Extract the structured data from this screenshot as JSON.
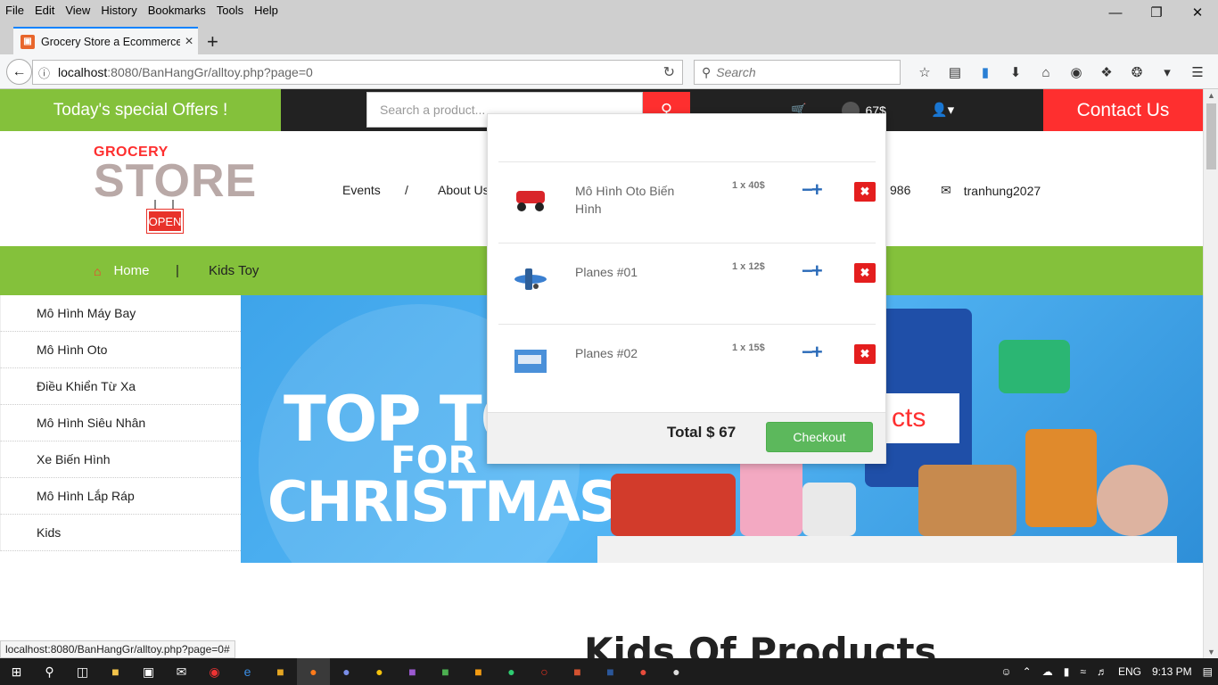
{
  "browser": {
    "menu": [
      "File",
      "Edit",
      "View",
      "History",
      "Bookmarks",
      "Tools",
      "Help"
    ],
    "tab_title": "Grocery Store a Ecommerce",
    "url_host": "localhost",
    "url_path": ":8080/BanHangGr/alltoy.php?page=0",
    "search_placeholder": "Search",
    "status_url": "localhost:8080/BanHangGr/alltoy.php?page=0#"
  },
  "header": {
    "offers": "Today's special Offers !",
    "search_placeholder": "Search a product...",
    "cart_amount": "67$",
    "contact": "Contact Us"
  },
  "logo": {
    "top": "GROCERY",
    "main": "STORE",
    "sign": "OPEN"
  },
  "midnav": {
    "events": "Events",
    "sep": "/",
    "about": "About Us",
    "phone": "986",
    "email": "tranhung2027"
  },
  "breadcrumb": {
    "home": "Home",
    "sep": "|",
    "current": "Kids Toy"
  },
  "categories": [
    "Mô Hình Máy Bay",
    "Mô Hình Oto",
    "Điều Khiển Từ Xa",
    "Mô Hình Siêu Nhân",
    "Xe Biến Hình",
    "Mô Hình Lắp Ráp",
    "Kids"
  ],
  "banner": {
    "line1": "TOP TO",
    "line2": "FOR",
    "line3": "CHRISTMAS",
    "cts": "cts"
  },
  "cart": {
    "items": [
      {
        "name": "Mô Hình Oto Biến Hình",
        "qty": "1 x 40$",
        "color": "#d9252a"
      },
      {
        "name": "Planes #01",
        "qty": "1 x 12$",
        "color": "#3a7fd0"
      },
      {
        "name": "Planes #02",
        "qty": "1 x 15$",
        "color": "#4a90d9"
      }
    ],
    "total": "Total $ 67",
    "checkout": "Checkout"
  },
  "section_title": "Kids Of Products",
  "taskbar": {
    "lang": "ENG",
    "time": "9:13 PM"
  }
}
